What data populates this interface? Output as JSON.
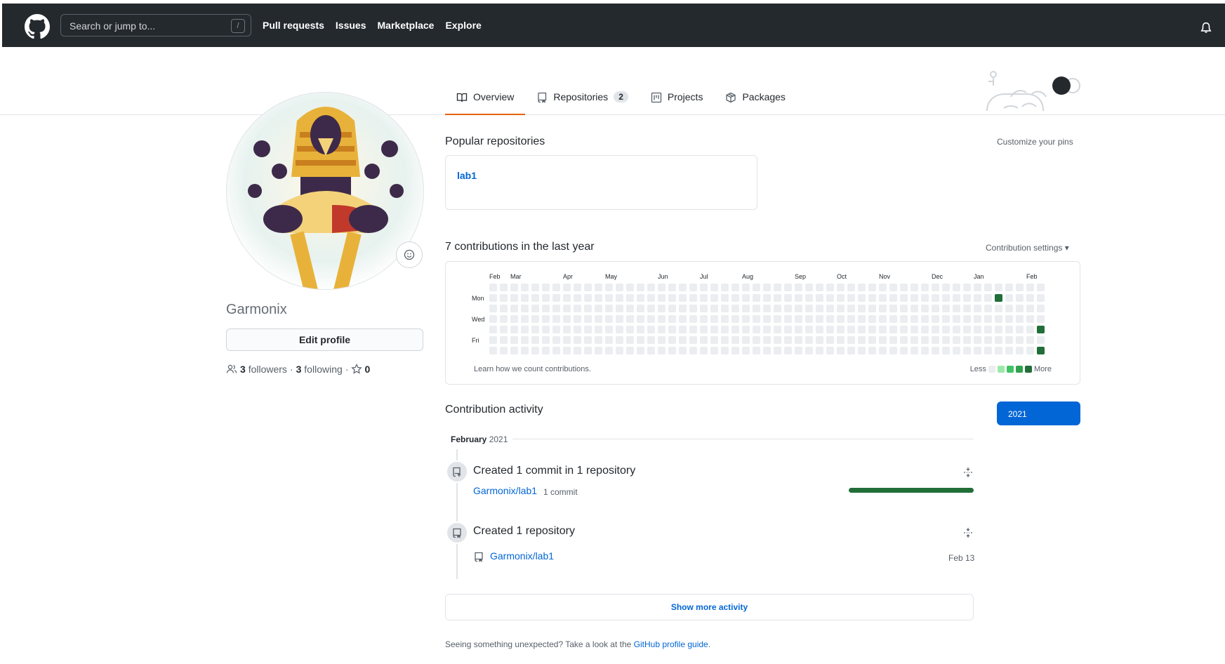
{
  "header": {
    "logo_icon": "github-mark-icon",
    "search_placeholder": "Search or jump to...",
    "search_shortcut": "/",
    "nav": [
      "Pull requests",
      "Issues",
      "Marketplace",
      "Explore"
    ],
    "bell_icon": "bell-icon"
  },
  "tabs": [
    {
      "label": "Overview",
      "icon": "book-icon",
      "active": true
    },
    {
      "label": "Repositories",
      "icon": "repo-icon",
      "count": "2"
    },
    {
      "label": "Projects",
      "icon": "project-icon"
    },
    {
      "label": "Packages",
      "icon": "package-icon"
    }
  ],
  "profile": {
    "username": "Garmonix",
    "edit_label": "Edit profile",
    "followers_count": "3",
    "followers_label": "followers",
    "following_count": "3",
    "following_label": "following",
    "stars_count": "0"
  },
  "pins": {
    "title": "Popular repositories",
    "customize": "Customize your pins",
    "items": [
      {
        "name": "lab1"
      }
    ]
  },
  "contributions": {
    "title": "7 contributions in the last year",
    "settings": "Contribution settings",
    "months": [
      "Feb",
      "Mar",
      "Apr",
      "May",
      "Jun",
      "Jul",
      "Aug",
      "Sep",
      "Oct",
      "Nov",
      "Dec",
      "Jan",
      "Feb"
    ],
    "days": [
      "Mon",
      "Wed",
      "Fri"
    ],
    "learn": "Learn how we count contributions.",
    "legend_less": "Less",
    "legend_more": "More",
    "levels": [
      "#ebedf0",
      "#9be9a8",
      "#40c463",
      "#30a14e",
      "#216e39"
    ]
  },
  "chart_data": {
    "type": "heatmap",
    "title": "7 contributions in the last year",
    "weeks": 53,
    "rows": [
      "Sun",
      "Mon",
      "Tue",
      "Wed",
      "Thu",
      "Fri",
      "Sat"
    ],
    "active_cells": [
      {
        "week": 48,
        "day": "Mon",
        "level": 4
      },
      {
        "week": 52,
        "day": "Thu",
        "level": 4
      },
      {
        "week": 52,
        "day": "Sat",
        "level": 4
      }
    ]
  },
  "activity": {
    "title": "Contribution activity",
    "year_button": "2021",
    "month": "February",
    "month_year": "2021",
    "items": [
      {
        "title": "Created 1 commit in 1 repository",
        "repo": "Garmonix/lab1",
        "meta": "1 commit",
        "bar": 1.0
      },
      {
        "title": "Created 1 repository",
        "repo": "Garmonix/lab1",
        "date": "Feb 13"
      }
    ],
    "show_more": "Show more activity"
  },
  "footer": {
    "note_prefix": "Seeing something unexpected? Take a look at the ",
    "note_link": "GitHub profile guide",
    "note_suffix": "."
  }
}
